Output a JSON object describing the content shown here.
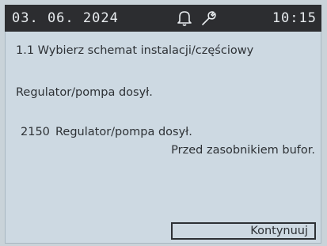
{
  "status_bar": {
    "date": "03. 06. 2024",
    "time": "10:15",
    "icons": [
      "bell-icon",
      "wrench-icon"
    ]
  },
  "menu": {
    "title": "1.1 Wybierz schemat instalacji/częściowy"
  },
  "selection": {
    "name": "Regulator/pompa dosył.",
    "code": "2150",
    "name_repeat": "Regulator/pompa dosył.",
    "description": "Przed zasobnikiem bufor."
  },
  "buttons": {
    "continue_label": "Kontynuuj"
  },
  "colors": {
    "status_bar_bg": "#2c2d30",
    "screen_bg": "#cdd9e2",
    "text": "#2d3135"
  }
}
